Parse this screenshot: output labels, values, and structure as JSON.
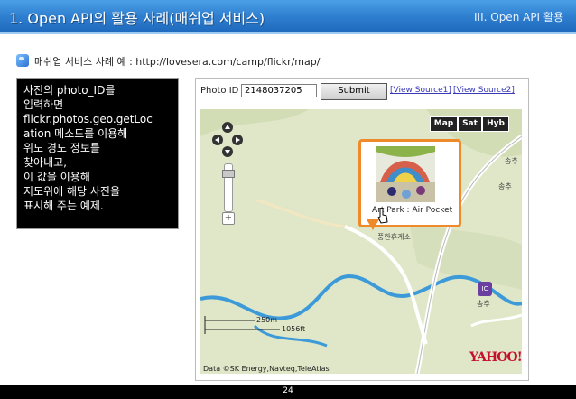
{
  "header": {
    "title": "1. Open API의 활용 사례(매쉬업 서비스)",
    "section": "III. Open API 활용"
  },
  "subtitle": "매쉬업 서비스 사례 예 : http://lovesera.com/camp/flickr/map/",
  "description": "사진의 photo_ID를\n입력하면\nflickr.photos.geo.getLoc\nation 메소드를 이용해\n위도 경도 정보를\n찾아내고,\n이 값을 이용해\n지도위에 해당 사진을\n표시해 주는 예제.",
  "app": {
    "photo_id_label": "Photo ID",
    "photo_id_value": "2148037205",
    "submit_label": "Submit",
    "view_source_1": "[View Source1]",
    "view_source_2": "[View Source2]"
  },
  "map": {
    "buttons": [
      "Map",
      "Sat",
      "Hyb"
    ],
    "popup_caption": "Art Park : Air Pocket",
    "labels": [
      "송추",
      "송추",
      "풍한휴게소",
      "송추"
    ],
    "ic_label": "IC",
    "scale_metric": "250m",
    "scale_imperial": "1056ft",
    "attribution": "Data ©SK Energy,Navteq,TeleAtlas",
    "logo": "YAHOO!"
  },
  "footer": {
    "page_number": "24"
  },
  "colors": {
    "header_blue": "#2f7fd0",
    "popup_orange": "#ee8a2a",
    "map_land": "#dfe7c8",
    "river": "#3d9ad9"
  }
}
